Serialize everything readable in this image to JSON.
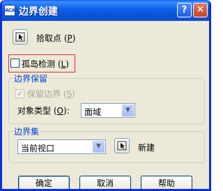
{
  "window": {
    "title": "边界创建",
    "icon_text": "ACAD",
    "help_glyph": "?",
    "close_glyph": "✕"
  },
  "pick_points": {
    "label": "拾取点 (P)",
    "label_main": "拾取点",
    "label_key": "(",
    "label_key_letter": "P",
    "label_key_end": ")"
  },
  "island_detection": {
    "label_main": "孤岛检测 (",
    "label_key": "L",
    "label_end": ")",
    "checked": false
  },
  "boundary_retention": {
    "legend": "边界保留",
    "retain_label_main": "保留边界 (",
    "retain_label_key": "S",
    "retain_label_end": ")",
    "retain_checked": true,
    "object_type_label_main": "对象类型 (",
    "object_type_label_key": "O",
    "object_type_label_end": "):",
    "object_type_value": "面域"
  },
  "boundary_set": {
    "legend": "边界集",
    "selected": "当前视口",
    "new_label": "新建"
  },
  "buttons": {
    "ok": "确定",
    "cancel": "取消",
    "help": "帮助"
  },
  "colors": {
    "titlebar": "#0b5fe8",
    "dialog_bg": "#ece9d8",
    "group_legend": "#0046d5",
    "highlight_box": "#e0302c"
  }
}
